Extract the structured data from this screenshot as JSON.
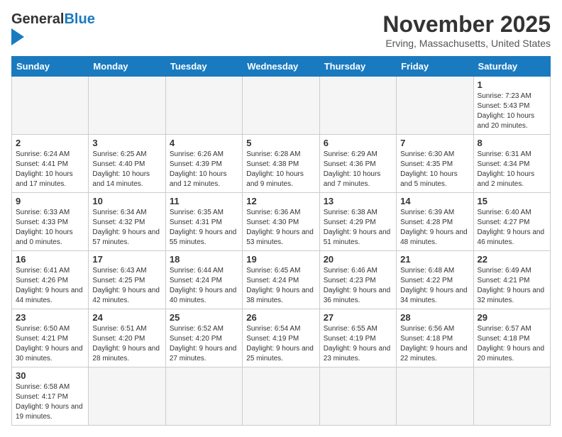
{
  "header": {
    "logo_text_general": "General",
    "logo_text_blue": "Blue",
    "title": "November 2025",
    "subtitle": "Erving, Massachusetts, United States"
  },
  "days_of_week": [
    "Sunday",
    "Monday",
    "Tuesday",
    "Wednesday",
    "Thursday",
    "Friday",
    "Saturday"
  ],
  "weeks": [
    [
      {
        "day": "",
        "info": ""
      },
      {
        "day": "",
        "info": ""
      },
      {
        "day": "",
        "info": ""
      },
      {
        "day": "",
        "info": ""
      },
      {
        "day": "",
        "info": ""
      },
      {
        "day": "",
        "info": ""
      },
      {
        "day": "1",
        "info": "Sunrise: 7:23 AM\nSunset: 5:43 PM\nDaylight: 10 hours and 20 minutes."
      }
    ],
    [
      {
        "day": "2",
        "info": "Sunrise: 6:24 AM\nSunset: 4:41 PM\nDaylight: 10 hours and 17 minutes."
      },
      {
        "day": "3",
        "info": "Sunrise: 6:25 AM\nSunset: 4:40 PM\nDaylight: 10 hours and 14 minutes."
      },
      {
        "day": "4",
        "info": "Sunrise: 6:26 AM\nSunset: 4:39 PM\nDaylight: 10 hours and 12 minutes."
      },
      {
        "day": "5",
        "info": "Sunrise: 6:28 AM\nSunset: 4:38 PM\nDaylight: 10 hours and 9 minutes."
      },
      {
        "day": "6",
        "info": "Sunrise: 6:29 AM\nSunset: 4:36 PM\nDaylight: 10 hours and 7 minutes."
      },
      {
        "day": "7",
        "info": "Sunrise: 6:30 AM\nSunset: 4:35 PM\nDaylight: 10 hours and 5 minutes."
      },
      {
        "day": "8",
        "info": "Sunrise: 6:31 AM\nSunset: 4:34 PM\nDaylight: 10 hours and 2 minutes."
      }
    ],
    [
      {
        "day": "9",
        "info": "Sunrise: 6:33 AM\nSunset: 4:33 PM\nDaylight: 10 hours and 0 minutes."
      },
      {
        "day": "10",
        "info": "Sunrise: 6:34 AM\nSunset: 4:32 PM\nDaylight: 9 hours and 57 minutes."
      },
      {
        "day": "11",
        "info": "Sunrise: 6:35 AM\nSunset: 4:31 PM\nDaylight: 9 hours and 55 minutes."
      },
      {
        "day": "12",
        "info": "Sunrise: 6:36 AM\nSunset: 4:30 PM\nDaylight: 9 hours and 53 minutes."
      },
      {
        "day": "13",
        "info": "Sunrise: 6:38 AM\nSunset: 4:29 PM\nDaylight: 9 hours and 51 minutes."
      },
      {
        "day": "14",
        "info": "Sunrise: 6:39 AM\nSunset: 4:28 PM\nDaylight: 9 hours and 48 minutes."
      },
      {
        "day": "15",
        "info": "Sunrise: 6:40 AM\nSunset: 4:27 PM\nDaylight: 9 hours and 46 minutes."
      }
    ],
    [
      {
        "day": "16",
        "info": "Sunrise: 6:41 AM\nSunset: 4:26 PM\nDaylight: 9 hours and 44 minutes."
      },
      {
        "day": "17",
        "info": "Sunrise: 6:43 AM\nSunset: 4:25 PM\nDaylight: 9 hours and 42 minutes."
      },
      {
        "day": "18",
        "info": "Sunrise: 6:44 AM\nSunset: 4:24 PM\nDaylight: 9 hours and 40 minutes."
      },
      {
        "day": "19",
        "info": "Sunrise: 6:45 AM\nSunset: 4:24 PM\nDaylight: 9 hours and 38 minutes."
      },
      {
        "day": "20",
        "info": "Sunrise: 6:46 AM\nSunset: 4:23 PM\nDaylight: 9 hours and 36 minutes."
      },
      {
        "day": "21",
        "info": "Sunrise: 6:48 AM\nSunset: 4:22 PM\nDaylight: 9 hours and 34 minutes."
      },
      {
        "day": "22",
        "info": "Sunrise: 6:49 AM\nSunset: 4:21 PM\nDaylight: 9 hours and 32 minutes."
      }
    ],
    [
      {
        "day": "23",
        "info": "Sunrise: 6:50 AM\nSunset: 4:21 PM\nDaylight: 9 hours and 30 minutes."
      },
      {
        "day": "24",
        "info": "Sunrise: 6:51 AM\nSunset: 4:20 PM\nDaylight: 9 hours and 28 minutes."
      },
      {
        "day": "25",
        "info": "Sunrise: 6:52 AM\nSunset: 4:20 PM\nDaylight: 9 hours and 27 minutes."
      },
      {
        "day": "26",
        "info": "Sunrise: 6:54 AM\nSunset: 4:19 PM\nDaylight: 9 hours and 25 minutes."
      },
      {
        "day": "27",
        "info": "Sunrise: 6:55 AM\nSunset: 4:19 PM\nDaylight: 9 hours and 23 minutes."
      },
      {
        "day": "28",
        "info": "Sunrise: 6:56 AM\nSunset: 4:18 PM\nDaylight: 9 hours and 22 minutes."
      },
      {
        "day": "29",
        "info": "Sunrise: 6:57 AM\nSunset: 4:18 PM\nDaylight: 9 hours and 20 minutes."
      }
    ],
    [
      {
        "day": "30",
        "info": "Sunrise: 6:58 AM\nSunset: 4:17 PM\nDaylight: 9 hours and 19 minutes."
      },
      {
        "day": "",
        "info": ""
      },
      {
        "day": "",
        "info": ""
      },
      {
        "day": "",
        "info": ""
      },
      {
        "day": "",
        "info": ""
      },
      {
        "day": "",
        "info": ""
      },
      {
        "day": "",
        "info": ""
      }
    ]
  ]
}
